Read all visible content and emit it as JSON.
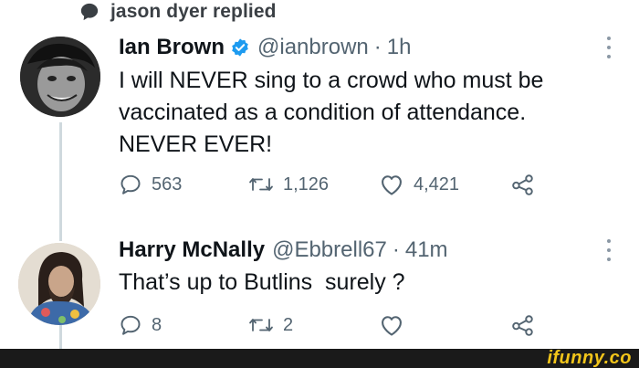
{
  "context": {
    "text": "jason dyer replied",
    "icon": "speech-bubble-icon"
  },
  "tweets": [
    {
      "name": "Ian Brown",
      "verified": true,
      "handle": "@ianbrown",
      "separator": "·",
      "time": "1h",
      "text": "I will NEVER sing to a crowd who must be vaccinated as a condition of attendance. NEVER EVER!",
      "counts": {
        "replies": "563",
        "retweets": "1,126",
        "likes": "4,421"
      }
    },
    {
      "name": "Harry McNally",
      "verified": false,
      "handle": "@Ebbrell67",
      "separator": "·",
      "time": "41m",
      "text": "That’s up to Butlins  surely ?",
      "counts": {
        "replies": "8",
        "retweets": "2"
      }
    }
  ],
  "footer": {
    "watermark": "ifunny.co"
  },
  "colors": {
    "verified": "#1d9bf0",
    "muted": "#536471",
    "thread_line": "#cfd9de",
    "watermark": "#f2c51a"
  }
}
